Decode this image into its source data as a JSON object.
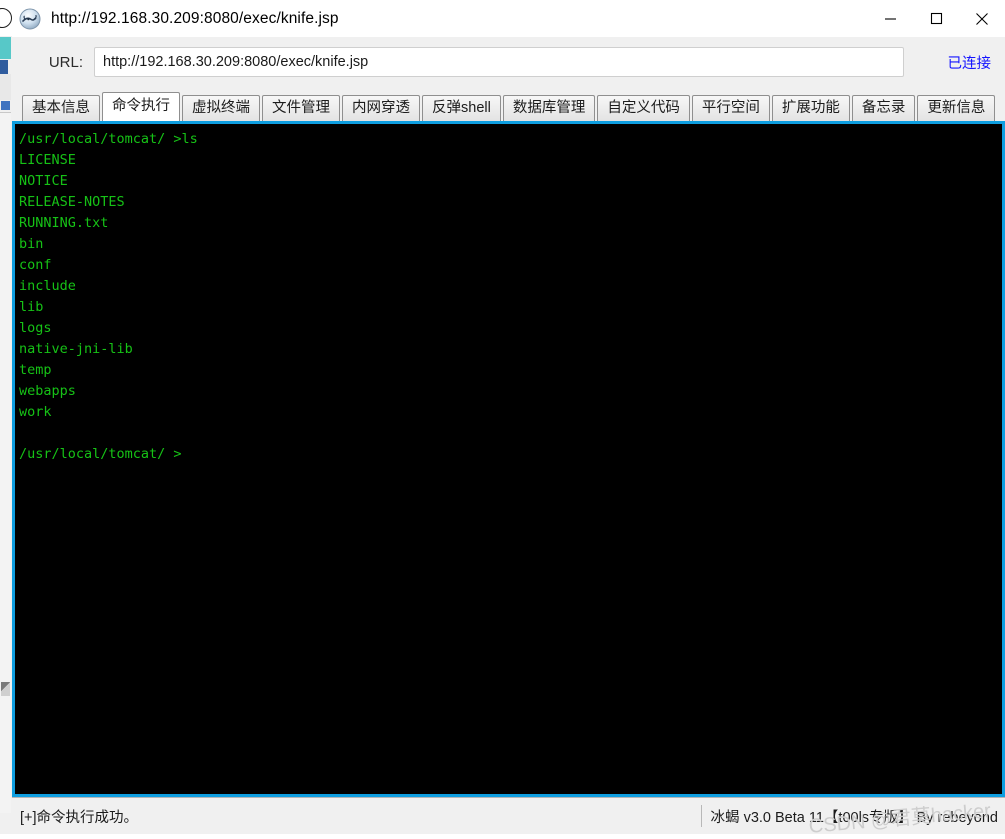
{
  "window": {
    "title": "http://192.168.30.209:8080/exec/knife.jsp",
    "icon": "scorpion-logo-icon",
    "controls": {
      "minimize": "minimize-icon",
      "maximize": "maximize-icon",
      "close": "close-icon"
    }
  },
  "url_bar": {
    "label": "URL:",
    "value": "http://192.168.30.209:8080/exec/knife.jsp",
    "placeholder": "http://",
    "connection_status": "已连接",
    "connection_status_color": "#1414ff"
  },
  "tabs": {
    "active_index": 1,
    "items": [
      {
        "label": "基本信息"
      },
      {
        "label": "命令执行"
      },
      {
        "label": "虚拟终端"
      },
      {
        "label": "文件管理"
      },
      {
        "label": "内网穿透"
      },
      {
        "label": "反弹shell"
      },
      {
        "label": "数据库管理"
      },
      {
        "label": "自定义代码"
      },
      {
        "label": "平行空间"
      },
      {
        "label": "扩展功能"
      },
      {
        "label": "备忘录"
      },
      {
        "label": "更新信息"
      }
    ]
  },
  "terminal": {
    "background_color": "#000000",
    "text_color": "#16c216",
    "border_color": "#0e9ee0",
    "lines": [
      "/usr/local/tomcat/ >ls",
      "LICENSE",
      "NOTICE",
      "RELEASE-NOTES",
      "RUNNING.txt",
      "bin",
      "conf",
      "include",
      "lib",
      "logs",
      "native-jni-lib",
      "temp",
      "webapps",
      "work",
      "",
      "/usr/local/tomcat/ >"
    ]
  },
  "status_bar": {
    "left_text": "[+]命令执行成功。",
    "right_text": "冰蝎 v3.0 Beta 11【t00ls专版】 By rebeyond",
    "watermark": "CSDN @君莫hacker"
  }
}
